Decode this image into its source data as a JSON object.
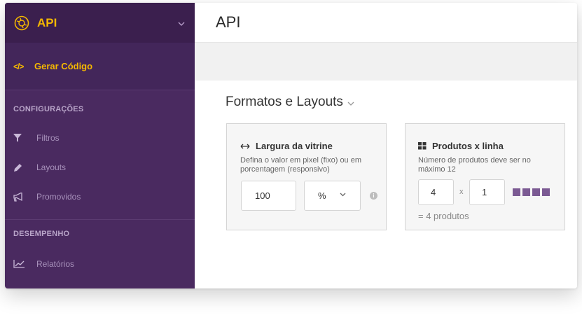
{
  "sidebar": {
    "header_title": "API",
    "active_item": "Gerar Código",
    "section_config": "CONFIGURAÇÕES",
    "items_config": [
      {
        "label": "Filtros",
        "icon": "filter-icon"
      },
      {
        "label": "Layouts",
        "icon": "pencil-icon"
      },
      {
        "label": "Promovidos",
        "icon": "megaphone-icon"
      }
    ],
    "section_perf": "DESEMPENHO",
    "items_perf": [
      {
        "label": "Relatórios",
        "icon": "line-chart-icon"
      }
    ]
  },
  "main": {
    "title": "API",
    "section_title": "Formatos e Layouts",
    "card_width": {
      "title": "Largura da vitrine",
      "description": "Defina o valor em pixel (fixo) ou em porcentagem (responsivo)",
      "value": "100",
      "unit": "%"
    },
    "card_products": {
      "title": "Produtos x linha",
      "description": "Número de produtos deve ser no máximo 12",
      "columns": "4",
      "times": "x",
      "rows": "1",
      "total": "= 4 produtos"
    }
  },
  "colors": {
    "sidebar_bg": "#4a2a60",
    "sidebar_header_bg": "#3b1f4e",
    "accent": "#f5b800",
    "grid_square": "#7b5a93"
  }
}
